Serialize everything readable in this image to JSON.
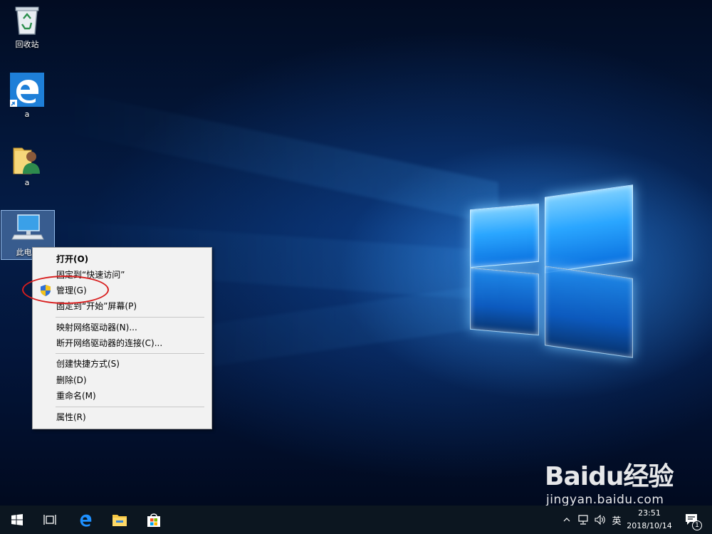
{
  "desktop": {
    "icons": [
      {
        "label": "回收站",
        "icon": "recycle-bin-icon"
      },
      {
        "label": "a",
        "icon": "edge-browser-icon"
      },
      {
        "label": "a",
        "icon": "user-folder-icon"
      },
      {
        "label": "此电脑",
        "icon": "computer-icon"
      }
    ]
  },
  "context_menu": {
    "items": [
      {
        "label": "打开(O)",
        "bold": true
      },
      {
        "label": "固定到“快速访问”"
      },
      {
        "label": "管理(G)",
        "icon": "uac-shield-icon"
      },
      {
        "label": "固定到“开始”屏幕(P)"
      },
      {
        "label": "映射网络驱动器(N)..."
      },
      {
        "label": "断开网络驱动器的连接(C)..."
      },
      {
        "label": "创建快捷方式(S)"
      },
      {
        "label": "删除(D)"
      },
      {
        "label": "重命名(M)"
      },
      {
        "label": "属性(R)"
      }
    ],
    "annotation_color": "#d81e1e"
  },
  "taskbar": {
    "buttons": [
      "start-windows-icon",
      "task-view-icon",
      "edge-icon",
      "file-explorer-icon",
      "store-icon"
    ],
    "tray": {
      "input_method": "英",
      "icons": [
        "chevron-up-icon",
        "network-icon",
        "volume-icon"
      ],
      "time": "23:51",
      "date": "2018/10/14",
      "notification_count": "1"
    }
  },
  "watermark": {
    "brand": "Baidu经验",
    "url": "jingyan.baidu.com"
  },
  "colors": {
    "accent_blue": "#1a8cff",
    "menu_bg": "#f2f2f2",
    "taskbar_bg": "#0c1620"
  }
}
